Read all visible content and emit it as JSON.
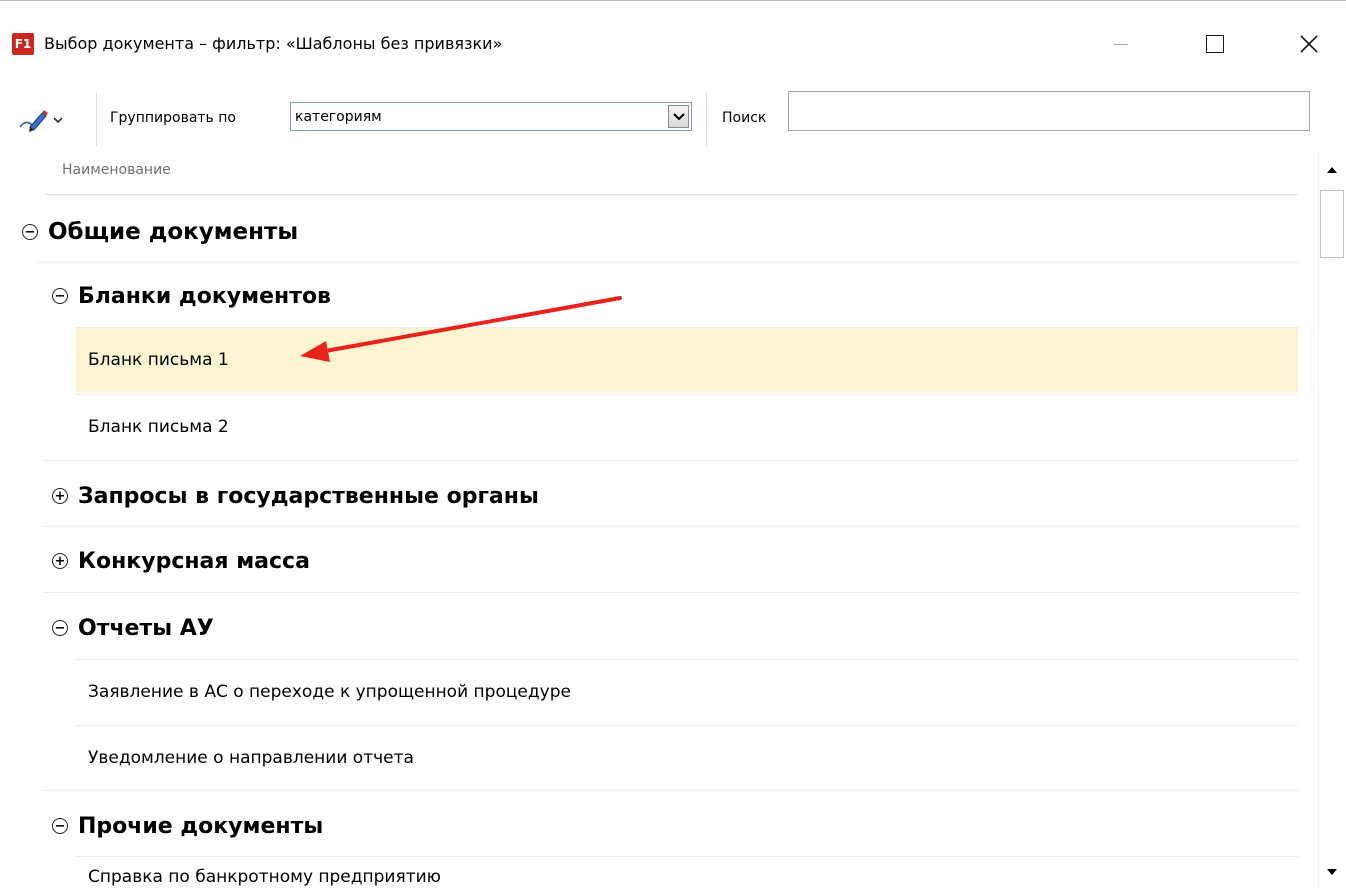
{
  "window": {
    "logo_text": "F1",
    "title": "Выбор документа – фильтр: «Шаблоны без привязки»",
    "minimize_icon": "minimize-icon",
    "maximize_icon": "maximize-icon",
    "close_icon": "close-icon"
  },
  "toolbar": {
    "tools_icon": "pen-menu-icon",
    "group_label": "Группировать по",
    "group_value": "категориям",
    "search_label": "Поиск",
    "search_value": "",
    "search_placeholder": ""
  },
  "tree": {
    "column_header": "Наименование",
    "groups": [
      {
        "label": "Общие документы",
        "expanded": true,
        "toggle": "−"
      },
      {
        "label": "Бланки документов",
        "expanded": true,
        "toggle": "−",
        "items": [
          "Бланк письма 1",
          "Бланк письма 2"
        ]
      },
      {
        "label": "Запросы в государственные органы",
        "expanded": false,
        "toggle": "+"
      },
      {
        "label": "Конкурсная масса",
        "expanded": false,
        "toggle": "+"
      },
      {
        "label": "Отчеты АУ",
        "expanded": true,
        "toggle": "−",
        "items": [
          "Заявление в АС о переходе к упрощенной процедуре",
          "Уведомление о направлении отчета"
        ]
      },
      {
        "label": "Прочие документы",
        "expanded": true,
        "toggle": "−",
        "items": [
          "Справка по банкротному предприятию"
        ]
      }
    ],
    "selected_item": "Бланк письма 1",
    "selection_color": "#fdf5d2"
  },
  "annotation": {
    "color": "#e8231c"
  },
  "colors": {
    "logo": "#c8281e"
  }
}
